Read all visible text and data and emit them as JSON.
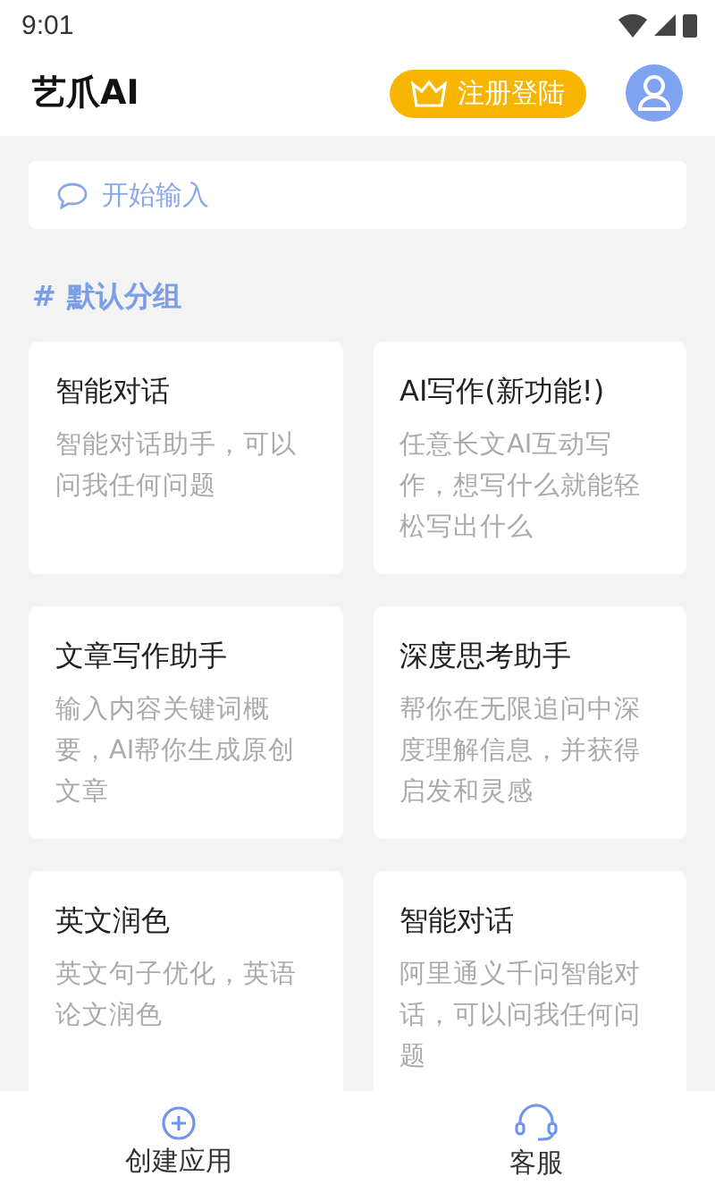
{
  "status_bar": {
    "time": "9:01"
  },
  "header": {
    "title": "艺爪AI",
    "login_button": "注册登陆"
  },
  "search": {
    "placeholder": "开始输入"
  },
  "section": {
    "hash": "#",
    "title": "默认分组"
  },
  "cards": [
    {
      "title": "智能对话",
      "description": "智能对话助手，可以问我任何问题"
    },
    {
      "title": "AI写作(新功能!)",
      "description": "任意长文AI互动写作，想写什么就能轻松写出什么"
    },
    {
      "title": "文章写作助手",
      "description": "输入内容关键词概要，AI帮你生成原创文章"
    },
    {
      "title": "深度思考助手",
      "description": "帮你在无限追问中深度理解信息，并获得启发和灵感"
    },
    {
      "title": "英文润色",
      "description": "英文句子优化，英语论文润色"
    },
    {
      "title": "智能对话",
      "description": "阿里通义千问智能对话，可以问我任何问题"
    }
  ],
  "bottom_nav": [
    {
      "kind": "create",
      "label": "创建应用"
    },
    {
      "kind": "support",
      "label": "客服"
    }
  ]
}
